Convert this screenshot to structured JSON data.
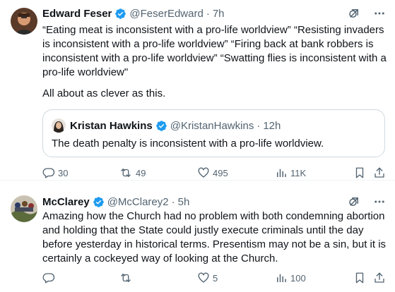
{
  "tweets": [
    {
      "author": {
        "name": "Edward Feser",
        "handle": "@FeserEdward",
        "time": "7h",
        "verified": true
      },
      "text": "“Eating meat is inconsistent with a pro-life worldview” “Resisting invaders is inconsistent with a pro-life worldview” “Firing back at bank robbers is inconsistent with a pro-life worldview” “Swatting flies is inconsistent with a pro-life worldview\"",
      "text2": "All about as clever as this.",
      "quote": {
        "author": {
          "name": "Kristan Hawkins",
          "handle": "@KristanHawkins",
          "time": "12h",
          "verified": true
        },
        "text": "The death penalty is inconsistent with a pro-life worldview."
      },
      "stats": {
        "replies": "30",
        "reposts": "49",
        "likes": "495",
        "views": "11K"
      }
    },
    {
      "author": {
        "name": "McClarey",
        "handle": "@McClarey2",
        "time": "5h",
        "verified": true
      },
      "text": "Amazing how the Church had no problem with both condemning abortion and holding that the State could justly execute criminals until the day before yesterday in historical terms.  Presentism may not be a sin, but it is certainly a cockeyed way of looking at the Church.",
      "stats": {
        "replies": "",
        "reposts": "",
        "likes": "5",
        "views": "100"
      }
    }
  ],
  "separator": "·",
  "colors": {
    "text": "#0f1419",
    "secondary": "#536471",
    "verified": "#1d9bf0",
    "border": "#cfd9de"
  },
  "icons": [
    "grok-icon",
    "more-icon",
    "reply-icon",
    "repost-icon",
    "like-icon",
    "views-icon",
    "bookmark-icon",
    "share-icon",
    "verified-badge-icon"
  ]
}
